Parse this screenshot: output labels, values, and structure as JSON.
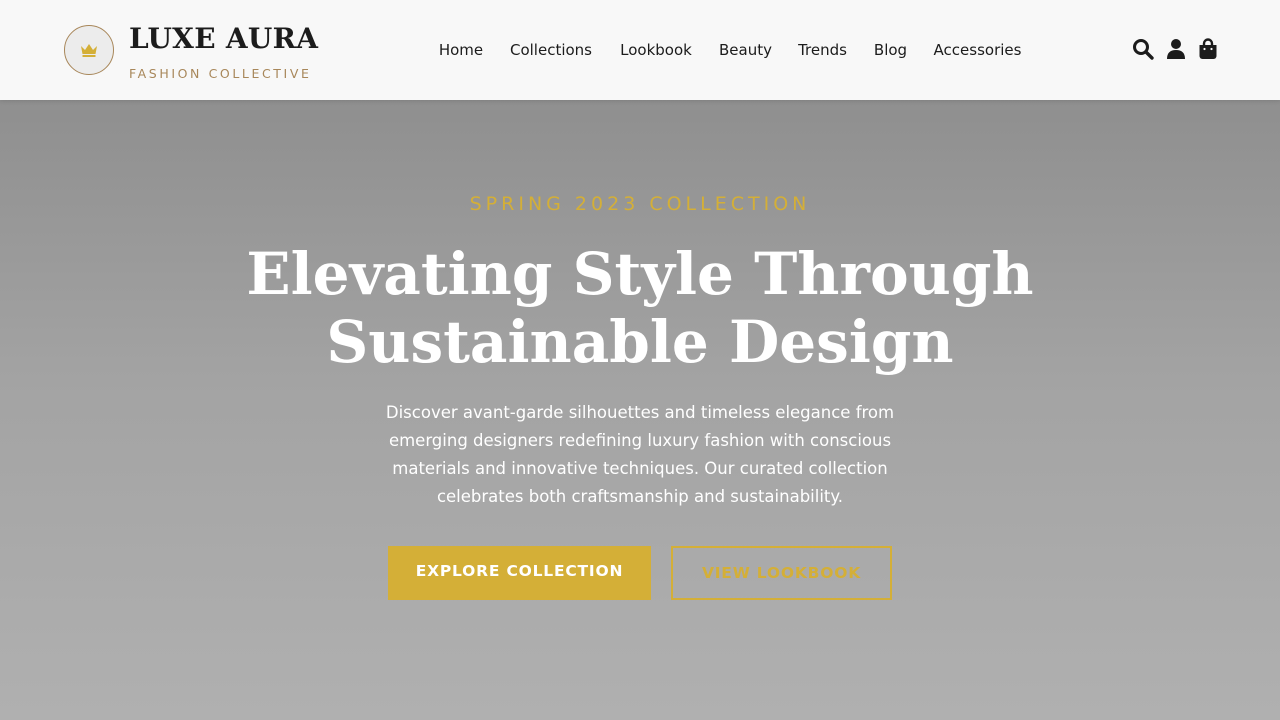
{
  "brand": {
    "name": "LUXE AURA",
    "tagline": "FASHION COLLECTIVE",
    "logo_icon": "crown-icon"
  },
  "nav": {
    "items": [
      {
        "label": "Home"
      },
      {
        "label": "Collections"
      },
      {
        "label": "Lookbook"
      },
      {
        "label": "Beauty"
      },
      {
        "label": "Trends"
      },
      {
        "label": "Blog"
      },
      {
        "label": "Accessories"
      }
    ]
  },
  "header_actions": {
    "icons": [
      "search-icon",
      "user-icon",
      "shopping-bag-icon"
    ]
  },
  "hero": {
    "eyebrow": "SPRING 2023 COLLECTION",
    "headline_line1": "Elevating Style Through",
    "headline_line2": "Sustainable Design",
    "description": "Discover avant-garde silhouettes and timeless elegance from emerging designers redefining luxury fashion with conscious materials and innovative techniques. Our curated collection celebrates both craftsmanship and sustainability.",
    "primary_cta": "EXPLORE COLLECTION",
    "secondary_cta": "VIEW LOOKBOOK"
  },
  "colors": {
    "accent_gold": "#d4af37",
    "brand_bronze": "#a8875a",
    "text_dark": "#1c1c1c",
    "header_bg": "#f8f8f8"
  }
}
